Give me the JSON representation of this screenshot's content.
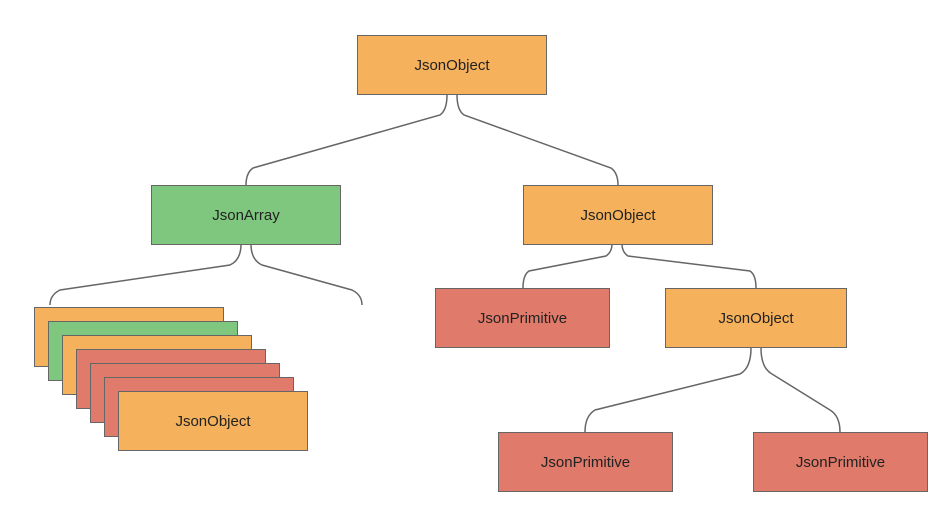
{
  "colors": {
    "orange": "#f5b15b",
    "green": "#7fc77f",
    "red": "#e07a6a"
  },
  "nodes": {
    "root": {
      "label": "JsonObject",
      "type": "JsonObject"
    },
    "left": {
      "label": "JsonArray",
      "type": "JsonArray"
    },
    "right": {
      "label": "JsonObject",
      "type": "JsonObject"
    },
    "rLeft": {
      "label": "JsonPrimitive",
      "type": "JsonPrimitive"
    },
    "rRight": {
      "label": "JsonObject",
      "type": "JsonObject"
    },
    "rrLeft": {
      "label": "JsonPrimitive",
      "type": "JsonPrimitive"
    },
    "rrRight": {
      "label": "JsonPrimitive",
      "type": "JsonPrimitive"
    },
    "stackFront": {
      "label": "JsonObject",
      "type": "JsonObject"
    }
  },
  "stack_layers": [
    {
      "color": "orange"
    },
    {
      "color": "green"
    },
    {
      "color": "orange"
    },
    {
      "color": "red"
    },
    {
      "color": "red"
    },
    {
      "color": "red"
    },
    {
      "color": "orange"
    }
  ],
  "structure": {
    "root": {
      "type": "JsonObject",
      "children": [
        {
          "type": "JsonArray",
          "children": "mixed-stack"
        },
        {
          "type": "JsonObject",
          "children": [
            {
              "type": "JsonPrimitive"
            },
            {
              "type": "JsonObject",
              "children": [
                {
                  "type": "JsonPrimitive"
                },
                {
                  "type": "JsonPrimitive"
                }
              ]
            }
          ]
        }
      ]
    }
  }
}
